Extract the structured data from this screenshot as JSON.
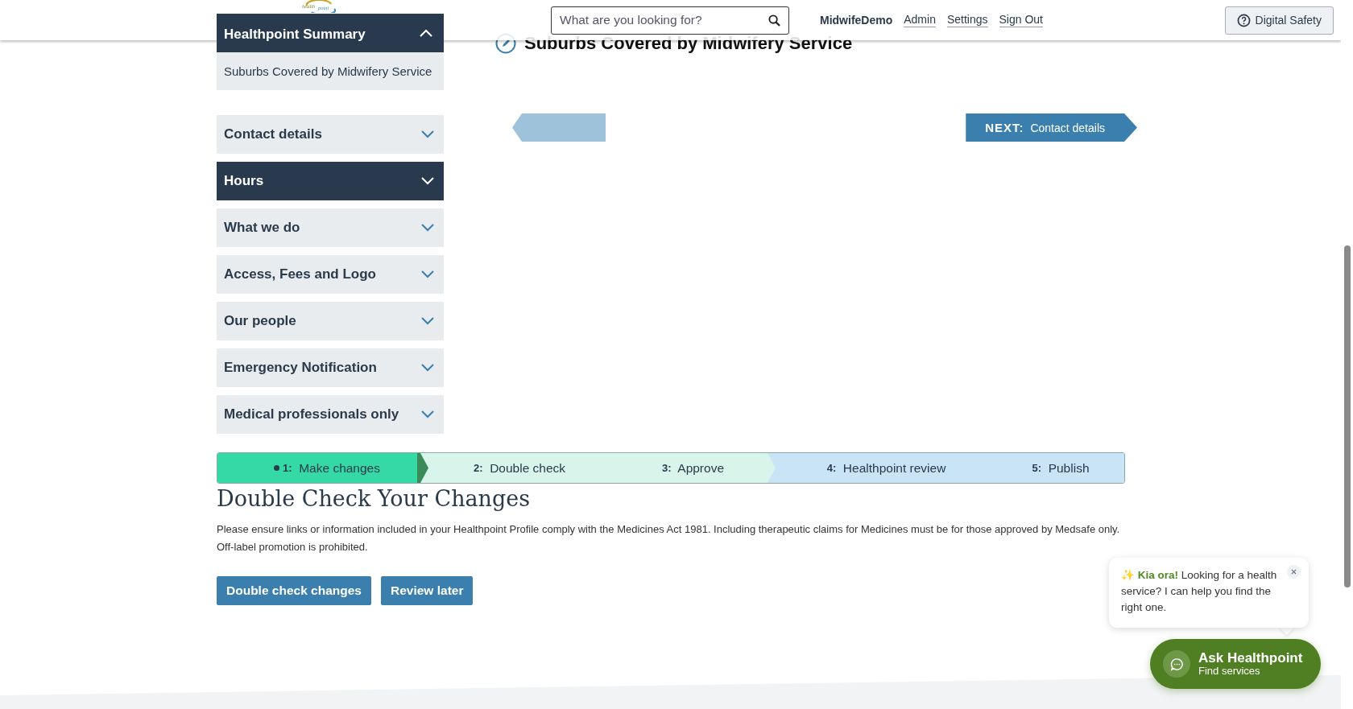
{
  "header": {
    "logo": {
      "line1": "health",
      "line2": "point"
    },
    "search": {
      "placeholder": "What are you looking for?"
    },
    "user": "MidwifeDemo",
    "links": [
      "Admin",
      "Settings",
      "Sign Out"
    ],
    "safety_button": "Digital Safety"
  },
  "sidebar": {
    "summary": {
      "title": "Healthpoint Summary",
      "expanded": true,
      "items": [
        "Suburbs Covered by Midwifery Service"
      ]
    },
    "sections": [
      {
        "label": "Contact details",
        "selected": false
      },
      {
        "label": "Hours",
        "selected": true
      },
      {
        "label": "What we do",
        "selected": false
      },
      {
        "label": "Access, Fees and Logo",
        "selected": false
      },
      {
        "label": "Our people",
        "selected": false
      },
      {
        "label": "Emergency Notification",
        "selected": false
      },
      {
        "label": "Medical professionals only",
        "selected": false
      }
    ]
  },
  "main": {
    "title": "Suburbs Covered by Midwifery Service",
    "next": {
      "label": "NEXT:",
      "target": "Contact details"
    }
  },
  "steps": [
    {
      "number": "1:",
      "label": "Make changes",
      "selected": true,
      "color": "#34d9a5"
    },
    {
      "number": "2:",
      "label": "Double check",
      "selected": false,
      "color": "#d8f5eb"
    },
    {
      "number": "3:",
      "label": "Approve",
      "selected": false,
      "color": "#d8f5eb"
    },
    {
      "number": "4:",
      "label": "Healthpoint review",
      "selected": false,
      "color": "#c9e3f7"
    },
    {
      "number": "5:",
      "label": "Publish",
      "selected": false,
      "color": "#c9e3f7"
    }
  ],
  "check": {
    "heading": "Double Check Your Changes",
    "text": "Please ensure links or information included in your Healthpoint Profile comply with the Medicines Act 1981. Including therapeutic claims for Medicines must be for those approved by Medsafe only. Off-label promotion is prohibited.",
    "buttons": [
      "Double check changes",
      "Review later"
    ]
  },
  "chat": {
    "icon": "✨",
    "greeting": "Kia ora!",
    "message": "Looking for a health service? I can help you find the right one.",
    "button_title": "Ask Healthpoint",
    "button_subtitle": "Find services"
  }
}
